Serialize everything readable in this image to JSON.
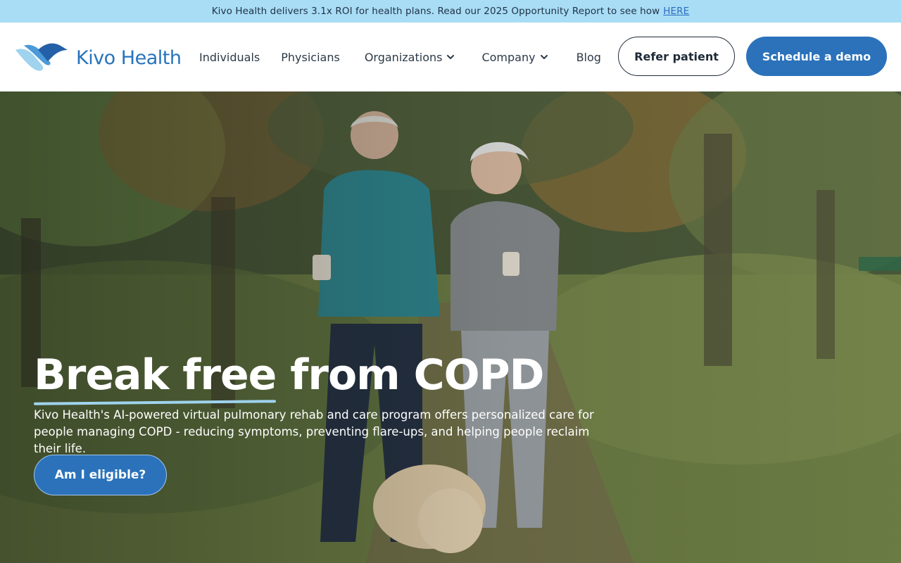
{
  "announcement": {
    "text": "Kivo Health delivers 3.1x ROI for health plans. Read our 2025 Opportunity Report to see how",
    "link_label": "HERE"
  },
  "brand": {
    "name": "Kivo Health",
    "color": "#2873bd"
  },
  "nav": {
    "items": [
      {
        "label": "Individuals"
      },
      {
        "label": "Physicians"
      },
      {
        "label": "Organizations",
        "dropdown": true
      },
      {
        "label": "Company",
        "dropdown": true
      },
      {
        "label": "Blog"
      }
    ],
    "refer_label": "Refer patient",
    "demo_label": "Schedule a demo"
  },
  "hero": {
    "headline_highlight": "Break free",
    "headline_rest": "from COPD",
    "subtext": "Kivo Health's AI-powered virtual pulmonary rehab and care program offers personalized care for people managing COPD - reducing symptoms, preventing flare-ups, and helping people reclaim their life.",
    "cta_label": "Am I eligible?",
    "accent_color": "#9fd3ee"
  }
}
